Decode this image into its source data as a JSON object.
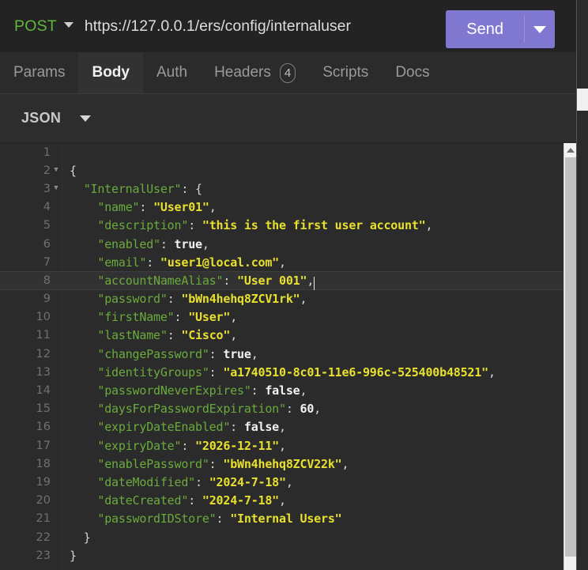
{
  "request_bar": {
    "method": "POST",
    "method_caret_icon": "chevron-down-icon",
    "url": "https://127.0.0.1/ers/config/internaluser",
    "send_label": "Send",
    "send_caret_icon": "chevron-down-icon"
  },
  "tabs": [
    {
      "label": "Params",
      "active": false,
      "badge": null
    },
    {
      "label": "Body",
      "active": true,
      "badge": null
    },
    {
      "label": "Auth",
      "active": false,
      "badge": null
    },
    {
      "label": "Headers",
      "active": false,
      "badge": "4"
    },
    {
      "label": "Scripts",
      "active": false,
      "badge": null
    },
    {
      "label": "Docs",
      "active": false,
      "badge": null
    }
  ],
  "body_type": {
    "label": "JSON",
    "caret_icon": "chevron-down-icon"
  },
  "editor": {
    "active_line": 8,
    "cursor_line": 8,
    "lines": [
      {
        "no": "1",
        "fold": "",
        "text": ""
      },
      {
        "no": "2",
        "fold": "▼",
        "text": "{"
      },
      {
        "no": "3",
        "fold": "▼",
        "text": "  \"InternalUser\": {"
      },
      {
        "no": "4",
        "fold": "",
        "text": "    \"name\": \"User01\","
      },
      {
        "no": "5",
        "fold": "",
        "text": "    \"description\": \"this is the first user account\","
      },
      {
        "no": "6",
        "fold": "",
        "text": "    \"enabled\": true,"
      },
      {
        "no": "7",
        "fold": "",
        "text": "    \"email\": \"user1@local.com\","
      },
      {
        "no": "8",
        "fold": "",
        "text": "    \"accountNameAlias\": \"User 001\","
      },
      {
        "no": "9",
        "fold": "",
        "text": "    \"password\": \"bWn4hehq8ZCV1rk\","
      },
      {
        "no": "10",
        "fold": "",
        "text": "    \"firstName\": \"User\","
      },
      {
        "no": "11",
        "fold": "",
        "text": "    \"lastName\": \"Cisco\","
      },
      {
        "no": "12",
        "fold": "",
        "text": "    \"changePassword\": true,"
      },
      {
        "no": "13",
        "fold": "",
        "text": "    \"identityGroups\": \"a1740510-8c01-11e6-996c-525400b48521\","
      },
      {
        "no": "14",
        "fold": "",
        "text": "    \"passwordNeverExpires\": false,"
      },
      {
        "no": "15",
        "fold": "",
        "text": "    \"daysForPasswordExpiration\": 60,"
      },
      {
        "no": "16",
        "fold": "",
        "text": "    \"expiryDateEnabled\": false,"
      },
      {
        "no": "17",
        "fold": "",
        "text": "    \"expiryDate\": \"2026-12-11\","
      },
      {
        "no": "18",
        "fold": "",
        "text": "    \"enablePassword\": \"bWn4hehq8ZCV22k\","
      },
      {
        "no": "19",
        "fold": "",
        "text": "    \"dateModified\": \"2024-7-18\","
      },
      {
        "no": "20",
        "fold": "",
        "text": "    \"dateCreated\": \"2024-7-18\","
      },
      {
        "no": "21",
        "fold": "",
        "text": "    \"passwordIDStore\": \"Internal Users\""
      },
      {
        "no": "22",
        "fold": "",
        "text": "  }"
      },
      {
        "no": "23",
        "fold": "",
        "text": "}"
      }
    ]
  },
  "scrollbars": {
    "editor_up_arrow_icon": "triangle-up-icon",
    "editor_thumb": "editor-scroll-thumb",
    "page_thumb": "page-scroll-thumb"
  },
  "colors": {
    "accent_send": "#8077d1",
    "method_post": "#5fb83d",
    "json_key": "#6aab3d",
    "json_string": "#e8e02e",
    "json_literal": "#f2f2f2",
    "editor_bg": "#2b2b2b",
    "active_line_bg": "#323232"
  }
}
